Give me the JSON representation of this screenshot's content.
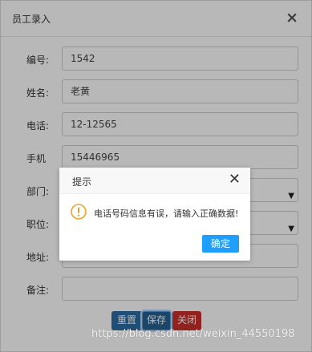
{
  "dialog": {
    "title": "员工录入",
    "close_icon": "×"
  },
  "form": {
    "fields": [
      {
        "label": "编号:",
        "value": "1542"
      },
      {
        "label": "姓名:",
        "value": "老黄"
      },
      {
        "label": "电话:",
        "value": "12-12565"
      },
      {
        "label": "手机",
        "value": "15446965"
      },
      {
        "label": "部门:",
        "value": ""
      },
      {
        "label": "职位:",
        "value": ""
      },
      {
        "label": "地址:",
        "value": ""
      },
      {
        "label": "备注:",
        "value": ""
      }
    ]
  },
  "buttons": {
    "reset": "重置",
    "save": "保存",
    "close": "关闭"
  },
  "alert": {
    "title": "提示",
    "close_icon": "✕",
    "icon": "warning-icon",
    "message": "电话号码信息有误，请输入正确数据!",
    "ok": "确定"
  },
  "watermark": "https://blog.csdn.net/weixin_44550198"
}
